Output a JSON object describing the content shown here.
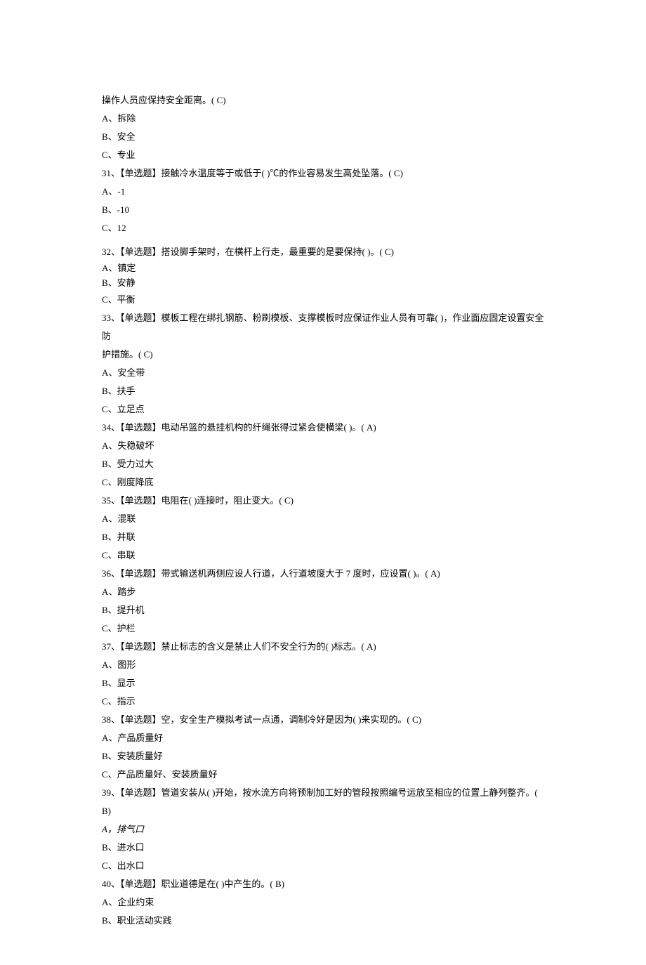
{
  "intro": "操作人员应保持安全距离。( C)",
  "intro_opts": [
    "A、拆除",
    "B、安全",
    "C、专业"
  ],
  "q31": {
    "text": "31、【单选题】接触冷水温度等于或低于( )℃的作业容易发生高处坠落。( C)",
    "opts": [
      "A、-1",
      "B、-10",
      "C、12"
    ]
  },
  "q32": {
    "text": "32、【单选题】搭设脚手架时，在横杆上行走，最重要的是要保持( )。( C)",
    "opts": [
      "A、镇定",
      "B、安静",
      "C、平衡"
    ]
  },
  "q33": {
    "text_a": "33、【单选题】模板工程在绑扎钢筋、粉刷模板、支撑模板时应保证作业人员有可靠( )，作业面应固定设置安全防",
    "text_b": "护措施。( C)",
    "opts": [
      "A、安全带",
      "B、扶手",
      "C、立足点"
    ]
  },
  "q34": {
    "text": "34、【单选题】电动吊篮的悬挂机构的纤绳张得过紧会使横梁( )。( A)",
    "opts": [
      "A、失稳破坏",
      "B、受力过大",
      "C、刚度降底"
    ]
  },
  "q35": {
    "text": "35、【单选题】电阻在( )连接时，阻止变大。( C)",
    "opts": [
      "A、混联",
      "B、并联",
      "C、串联"
    ]
  },
  "q36": {
    "text": "36、【单选题】带式输送机两侧应设人行道，人行道坡度大于 7 度时，应设置( )。( A)",
    "opts": [
      "A、踏步",
      "B、提升机",
      "C、护栏"
    ]
  },
  "q37": {
    "text": "37、【单选题】禁止标志的含义是禁止人们不安全行为的( )标志。( A)",
    "opts": [
      "A、图形",
      "B、显示",
      "C、指示"
    ]
  },
  "q38": {
    "text": "38、【单选题】空，安全生产模拟考试一点通，调制冷好是因为( )来实现的。( C)",
    "opts": [
      "A、产品质量好",
      "B、安装质量好",
      "C、产品质量好、安装质量好"
    ]
  },
  "q39": {
    "text": "39、【单选题】管道安装从( )开始，按水流方向将预制加工好的管段按照编号运放至相应的位置上静列整齐。( B)",
    "opts": [
      "A，排气口",
      "B、进水口",
      "C、出水口"
    ]
  },
  "q40": {
    "text": "40、【单选题】职业道德是在( )中产生的。( B)",
    "opts": [
      "A、企业约束",
      "B、职业活动实践"
    ]
  }
}
